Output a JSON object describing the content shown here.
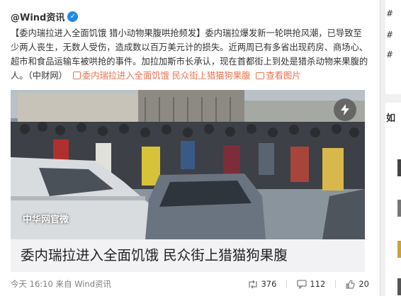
{
  "post": {
    "author": "@Wind资讯",
    "text_tag": "【委内瑞拉进入全面饥饿 猎小动物果腹哄抢频发】",
    "text_body": "委内瑞拉爆发新一轮哄抢风潮，已导致至少两人丧生，无数人受伤，造成数以百万美元计的损失。近两周已有多省出现药房、商场心、超市和食品运输车被哄抢的事件。加拉加斯市长承认，现在首都街上到处是猎杀动物来果腹的人。（中财网）",
    "link_text": "委内瑞拉进入全面饥饿 民众街上猎猫狗果腹",
    "view_image": "查看图片",
    "watermark": "中华网官微",
    "caption": "委内瑞拉进入全面饥饿 民众街上猎猫狗果腹",
    "time": "今天 16:10",
    "source_prefix": "来自",
    "source": "Wind资讯",
    "reposts": "376",
    "comments": "112",
    "likes": "20"
  },
  "right_column": {
    "hash_marks": [
      "#",
      "#",
      "#"
    ],
    "card_initial": "如"
  },
  "icons": {
    "verified": "verified-badge-icon",
    "flash": "lightning-icon",
    "repost": "repost-icon",
    "comment": "comment-icon",
    "like": "thumbs-up-icon"
  },
  "colors": {
    "link": "#eb7350",
    "verified": "#1f8ae6",
    "caption_bg": "#f2f2f5"
  }
}
